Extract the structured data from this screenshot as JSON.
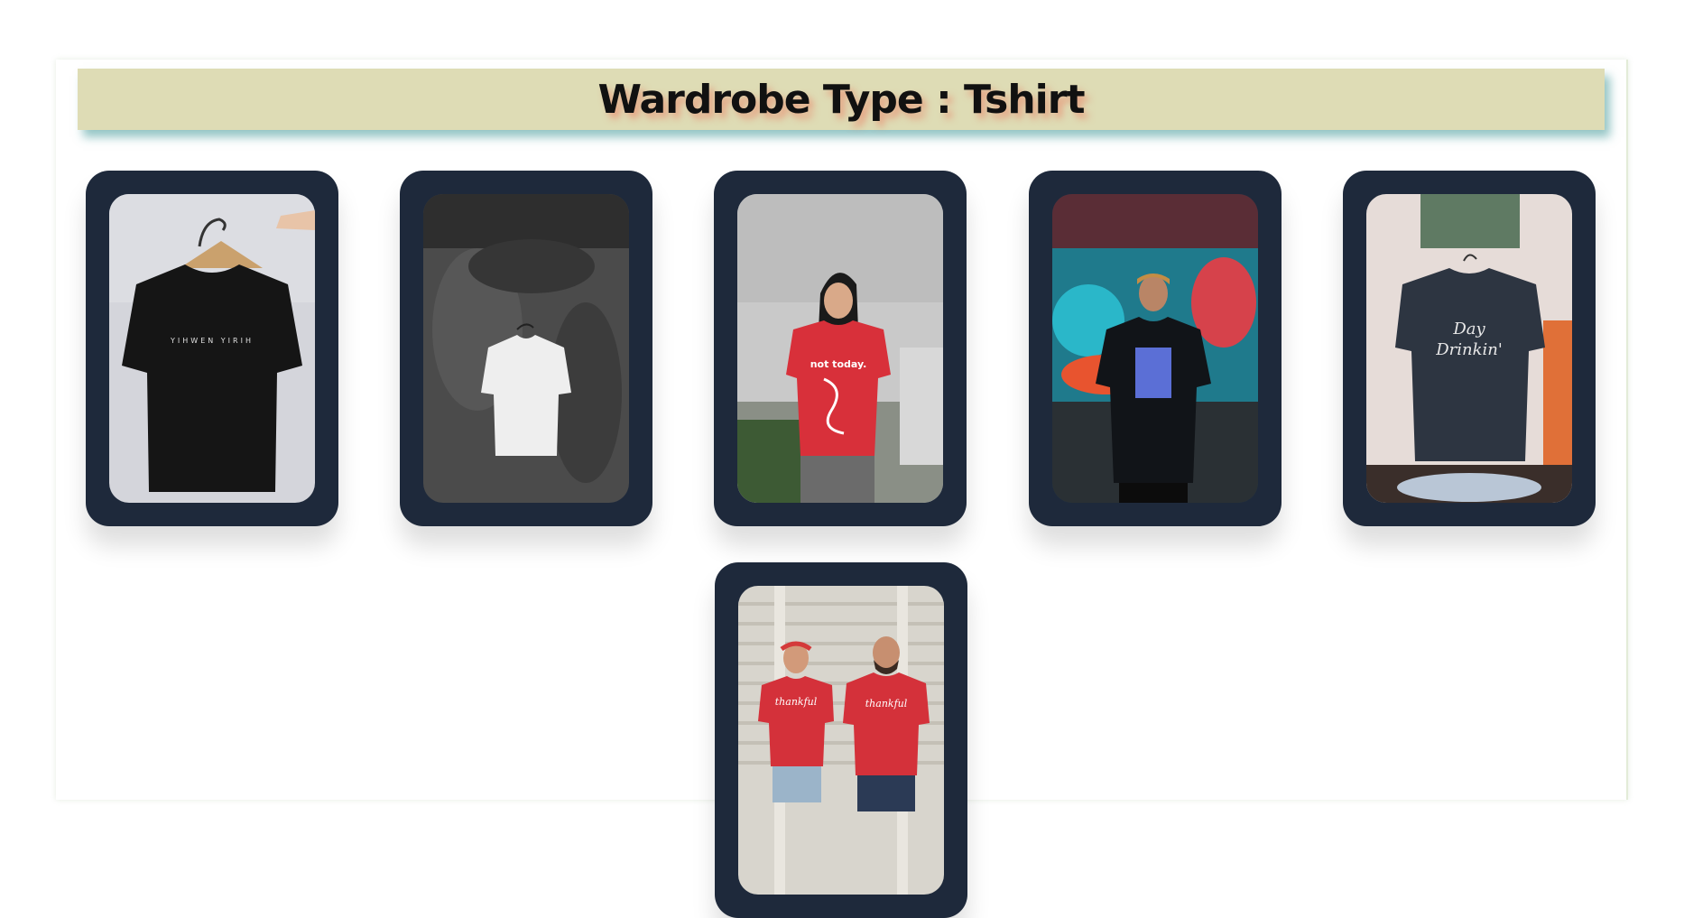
{
  "header": {
    "title": "Wardrobe Type : Tshirt"
  },
  "cards": [
    {
      "image": "black-tshirt-on-hanger-photo",
      "colors": {
        "bg": "#d5d6dc",
        "shirt": "#161616"
      }
    },
    {
      "image": "white-tshirt-on-concrete-wall-photo",
      "colors": {
        "bg": "#4a4a4a",
        "shirt": "#eeeeee"
      }
    },
    {
      "image": "woman-red-tshirt-photo",
      "colors": {
        "bg": "#c8c8c8",
        "shirt": "#d8303a",
        "shirt_text": "not today."
      }
    },
    {
      "image": "man-black-tshirt-graffiti-photo",
      "colors": {
        "bg": "#1b4e6a",
        "shirt": "#111418"
      }
    },
    {
      "image": "day-drinkin-tshirt-store-photo",
      "colors": {
        "bg": "#e6dcd8",
        "shirt": "#2c3440",
        "shirt_text": "Day Drinkin'"
      }
    },
    {
      "image": "couple-red-tshirts-photo",
      "colors": {
        "bg": "#d9d6cf",
        "shirt": "#d4313a",
        "shirt_text": "thankful"
      }
    }
  ]
}
